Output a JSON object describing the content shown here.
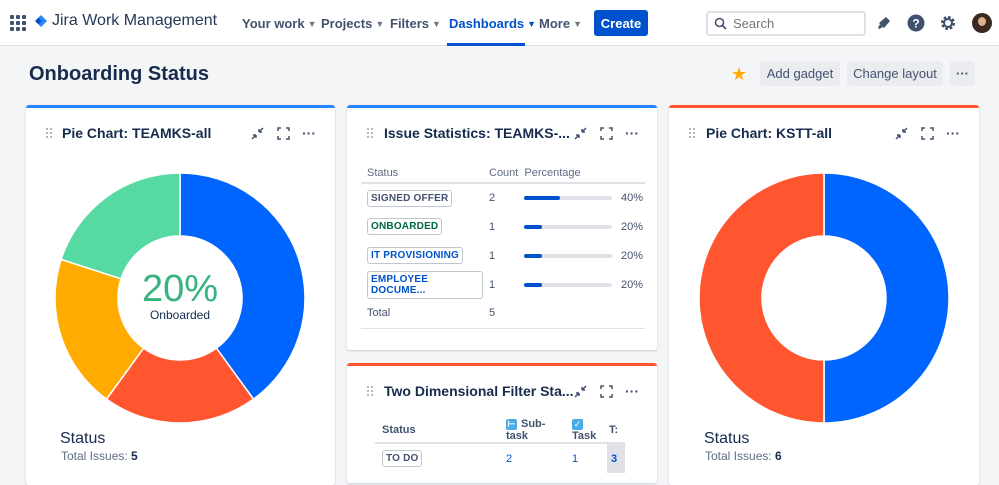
{
  "topbar": {
    "app_name": "Jira Work Management",
    "nav": [
      {
        "label": "Your work"
      },
      {
        "label": "Projects"
      },
      {
        "label": "Filters"
      },
      {
        "label": "Dashboards"
      },
      {
        "label": "More"
      }
    ],
    "create_label": "Create",
    "search_placeholder": "Search",
    "icons": [
      "app-switcher-icon",
      "notification-icon",
      "help-icon",
      "settings-icon"
    ]
  },
  "page": {
    "title": "Onboarding Status",
    "add_gadget_label": "Add gadget",
    "change_layout_label": "Change layout",
    "more_label": "···"
  },
  "colors": {
    "accent": "#0052cc",
    "blue": "#0065ff",
    "red": "#ff5630",
    "yellow": "#ffab00",
    "green": "#57d9a3"
  },
  "gadget1": {
    "title": "Pie Chart: TEAMKS-all",
    "center_percent": "20%",
    "center_label": "Onboarded",
    "legend_title": "Status",
    "total_label": "Total Issues:",
    "total_value": "5"
  },
  "gadget2": {
    "title": "Issue Statistics: TEAMKS-...",
    "headers": {
      "status": "Status",
      "count": "Count",
      "percentage": "Percentage"
    },
    "rows": [
      {
        "status": "SIGNED OFFER",
        "count": "2",
        "percent": "40%"
      },
      {
        "status": "ONBOARDED",
        "count": "1",
        "percent": "20%"
      },
      {
        "status": "IT PROVISIONING",
        "count": "1",
        "percent": "20%"
      },
      {
        "status": "EMPLOYEE DOCUME...",
        "count": "1",
        "percent": "20%"
      }
    ],
    "total_label": "Total",
    "total_value": "5"
  },
  "gadget3": {
    "title": "Two Dimensional Filter Sta...",
    "headers": {
      "status": "Status",
      "subtask": "Sub-task",
      "task": "Task",
      "t": "T:"
    },
    "rows": [
      {
        "status": "TO DO",
        "subtask": "2",
        "task": "1",
        "t": "3"
      }
    ]
  },
  "gadget4": {
    "title": "Pie Chart: KSTT-all",
    "legend_title": "Status",
    "total_label": "Total Issues:",
    "total_value": "6"
  },
  "chart_data": [
    {
      "type": "pie",
      "title": "Pie Chart: TEAMKS-all",
      "slices": [
        {
          "value": 2,
          "color": "#0065ff"
        },
        {
          "value": 1,
          "color": "#ff5630"
        },
        {
          "value": 1,
          "color": "#ffab00"
        },
        {
          "value": 1,
          "color": "#57d9a3"
        }
      ]
    },
    {
      "type": "pie",
      "title": "Pie Chart: KSTT-all",
      "slices": [
        {
          "value": 3,
          "color": "#0065ff"
        },
        {
          "value": 3,
          "color": "#ff5630"
        }
      ]
    }
  ]
}
